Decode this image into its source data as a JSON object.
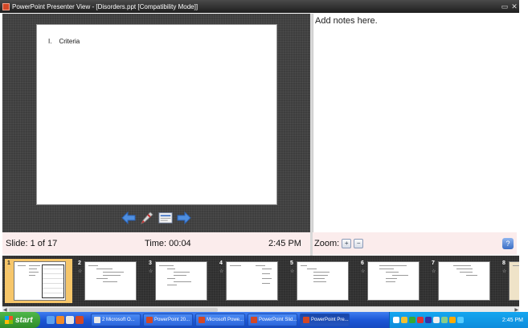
{
  "window": {
    "title": "PowerPoint Presenter View - [Disorders.ppt [Compatibility Mode]]",
    "minimize": "▭",
    "close": "✕"
  },
  "slide": {
    "bullet_number": "I.",
    "bullet_text": "Criteria"
  },
  "notes": {
    "text": "Add notes here."
  },
  "status": {
    "slide_counter": "Slide: 1 of 17",
    "timer": "Time: 00:04",
    "clock": "2:45 PM"
  },
  "zoom": {
    "label": "Zoom:",
    "zoom_in": "+",
    "zoom_out": "−",
    "help": "?"
  },
  "thumbnails": [
    {
      "number": "1",
      "selected": true
    },
    {
      "number": "2",
      "selected": false
    },
    {
      "number": "3",
      "selected": false
    },
    {
      "number": "4",
      "selected": false
    },
    {
      "number": "5",
      "selected": false
    },
    {
      "number": "6",
      "selected": false
    },
    {
      "number": "7",
      "selected": false
    },
    {
      "number": "8",
      "selected": false
    }
  ],
  "taskbar": {
    "start_label": "start",
    "tasks": [
      {
        "label": "2 Microsoft O...",
        "icon_color": "#e8e8e8",
        "active": false
      },
      {
        "label": "PowerPoint 20...",
        "icon_color": "#d24726",
        "active": false
      },
      {
        "label": "Microsoft Powe...",
        "icon_color": "#d24726",
        "active": false
      },
      {
        "label": "PowerPoint Slid...",
        "icon_color": "#d24726",
        "active": false
      },
      {
        "label": "PowerPoint Pre...",
        "icon_color": "#d24726",
        "active": true
      }
    ],
    "tray_clock": "2:45 PM"
  },
  "colors": {
    "status_bg": "#fbecec",
    "selected_thumb": "#f6c66a",
    "taskbar_blue": "#2c66dc"
  }
}
